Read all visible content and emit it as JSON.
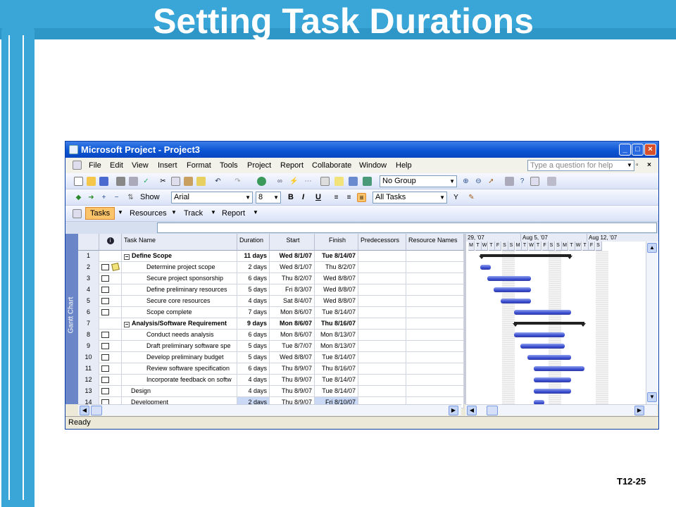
{
  "slide": {
    "title": "Setting Task Durations",
    "number": "T12-25"
  },
  "window": {
    "title": "Microsoft Project - Project3",
    "controls": [
      "_",
      "□",
      "×"
    ]
  },
  "menu": [
    "File",
    "Edit",
    "View",
    "Insert",
    "Format",
    "Tools",
    "Project",
    "Report",
    "Collaborate",
    "Window",
    "Help"
  ],
  "ask_placeholder": "Type a question for help",
  "toolbar1": {
    "group_combo": "No Group"
  },
  "toolbar2": {
    "show_label": "Show",
    "font": "Arial",
    "size": "8",
    "bold": "B",
    "italic": "I",
    "underline": "U",
    "filter": "All Tasks"
  },
  "toolbar3": {
    "tasks": "Tasks",
    "resources": "Resources",
    "track": "Track",
    "report": "Report"
  },
  "view_label": "Gantt Chart",
  "columns": [
    "Task Name",
    "Duration",
    "Start",
    "Finish",
    "Predecessors",
    "Resource Names"
  ],
  "tasks": [
    {
      "id": "1",
      "name": "Define Scope",
      "duration": "11 days",
      "start": "Wed 8/1/07",
      "finish": "Tue 8/14/07",
      "summary": true
    },
    {
      "id": "2",
      "name": "Determine project scope",
      "duration": "2 days",
      "start": "Wed 8/1/07",
      "finish": "Thu 8/2/07",
      "summary": false
    },
    {
      "id": "3",
      "name": "Secure project sponsorship",
      "duration": "6 days",
      "start": "Thu 8/2/07",
      "finish": "Wed 8/8/07",
      "summary": false
    },
    {
      "id": "4",
      "name": "Define preliminary resources",
      "duration": "5 days",
      "start": "Fri 8/3/07",
      "finish": "Wed 8/8/07",
      "summary": false
    },
    {
      "id": "5",
      "name": "Secure core resources",
      "duration": "4 days",
      "start": "Sat 8/4/07",
      "finish": "Wed 8/8/07",
      "summary": false
    },
    {
      "id": "6",
      "name": "Scope complete",
      "duration": "7 days",
      "start": "Mon 8/6/07",
      "finish": "Tue 8/14/07",
      "summary": false
    },
    {
      "id": "7",
      "name": "Analysis/Software Requirement",
      "duration": "9 days",
      "start": "Mon 8/6/07",
      "finish": "Thu 8/16/07",
      "summary": true
    },
    {
      "id": "8",
      "name": "Conduct needs analysis",
      "duration": "6 days",
      "start": "Mon 8/6/07",
      "finish": "Mon 8/13/07",
      "summary": false
    },
    {
      "id": "9",
      "name": "Draft preliminary software spe",
      "duration": "5 days",
      "start": "Tue 8/7/07",
      "finish": "Mon 8/13/07",
      "summary": false
    },
    {
      "id": "10",
      "name": "Develop preliminary budget",
      "duration": "5 days",
      "start": "Wed 8/8/07",
      "finish": "Tue 8/14/07",
      "summary": false
    },
    {
      "id": "11",
      "name": "Review software specification",
      "duration": "6 days",
      "start": "Thu 8/9/07",
      "finish": "Thu 8/16/07",
      "summary": false
    },
    {
      "id": "12",
      "name": "Incorporate feedback on softw",
      "duration": "4 days",
      "start": "Thu 8/9/07",
      "finish": "Tue 8/14/07",
      "summary": false
    },
    {
      "id": "13",
      "name": "Design",
      "duration": "4 days",
      "start": "Thu 8/9/07",
      "finish": "Tue 8/14/07",
      "summary": false
    },
    {
      "id": "14",
      "name": "Development",
      "duration": "2 days",
      "start": "Thu 8/9/07",
      "finish": "Fri 8/10/07",
      "summary": false
    }
  ],
  "gantt": {
    "weeks": [
      "29, '07",
      "Aug 5, '07",
      "Aug 12, '07"
    ],
    "days": [
      "M",
      "T",
      "W",
      "T",
      "F",
      "S",
      "S",
      "M",
      "T",
      "W",
      "T",
      "F",
      "S",
      "S",
      "M",
      "T",
      "W",
      "T",
      "F",
      "S"
    ]
  },
  "status": "Ready"
}
